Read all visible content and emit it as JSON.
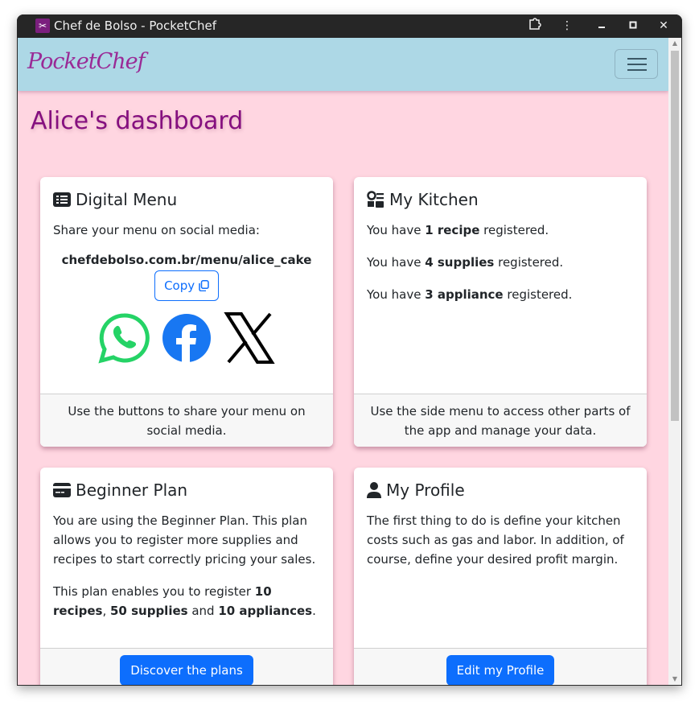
{
  "window": {
    "title": "Chef de Bolso - PocketChef",
    "controls": [
      "extensions",
      "menu",
      "minimize",
      "maximize",
      "close"
    ]
  },
  "navbar": {
    "brand": "PocketChef",
    "toggler_icon": "hamburger-icon"
  },
  "page": {
    "title": "Alice's dashboard"
  },
  "cards": {
    "digital_menu": {
      "title": "Digital Menu",
      "icon": "list-icon",
      "intro": "Share your menu on social media:",
      "menu_link": "chefdebolso.com.br/menu/alice_cake",
      "copy_label": "Copy",
      "socials": [
        "whatsapp",
        "facebook",
        "x"
      ],
      "footer": "Use the buttons to share your menu on social media."
    },
    "my_kitchen": {
      "title": "My Kitchen",
      "icon": "kitchen-icon",
      "lines": [
        {
          "prefix": "You have ",
          "bold": "1 recipe",
          "suffix": " registered."
        },
        {
          "prefix": "You have ",
          "bold": "4 supplies",
          "suffix": " registered."
        },
        {
          "prefix": "You have ",
          "bold": "3 appliance",
          "suffix": " registered."
        }
      ],
      "footer": "Use the side menu to access other parts of the app and manage your data."
    },
    "beginner_plan": {
      "title": "Beginner Plan",
      "icon": "credit-card-icon",
      "description": "You are using the Beginner Plan. This plan allows you to register more supplies and recipes to start correctly pricing your sales.",
      "limits": {
        "prefix": "This plan enables you to register ",
        "recipes": "10 recipes",
        "sep1": ", ",
        "supplies": "50 supplies",
        "sep2": " and ",
        "appliances": "10 appliances",
        "suffix": "."
      },
      "button": "Discover the plans"
    },
    "my_profile": {
      "title": "My Profile",
      "icon": "user-icon",
      "description": "The first thing to do is define your kitchen costs such as gas and labor. In addition, of course, define your desired profit margin.",
      "button": "Edit my Profile"
    }
  }
}
